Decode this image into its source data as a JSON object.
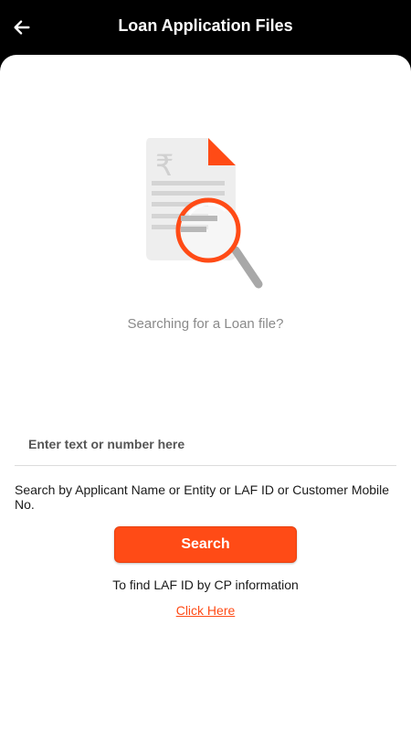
{
  "header": {
    "title": "Loan Application Files",
    "back_icon": "arrow-left-icon"
  },
  "illustration": {
    "icon": "document-search-icon",
    "currency_symbol": "₹"
  },
  "main": {
    "prompt": "Searching for a Loan file?",
    "search_placeholder": "Enter text or number here",
    "search_value": "",
    "hint": "Search by Applicant Name or Entity or LAF ID or Customer Mobile No.",
    "search_button_label": "Search",
    "cp_info_text": "To find LAF ID by CP information",
    "click_here_label": "Click Here"
  },
  "colors": {
    "accent": "#ff4b16",
    "header_bg": "#000000",
    "page_bg": "#ffffff"
  }
}
